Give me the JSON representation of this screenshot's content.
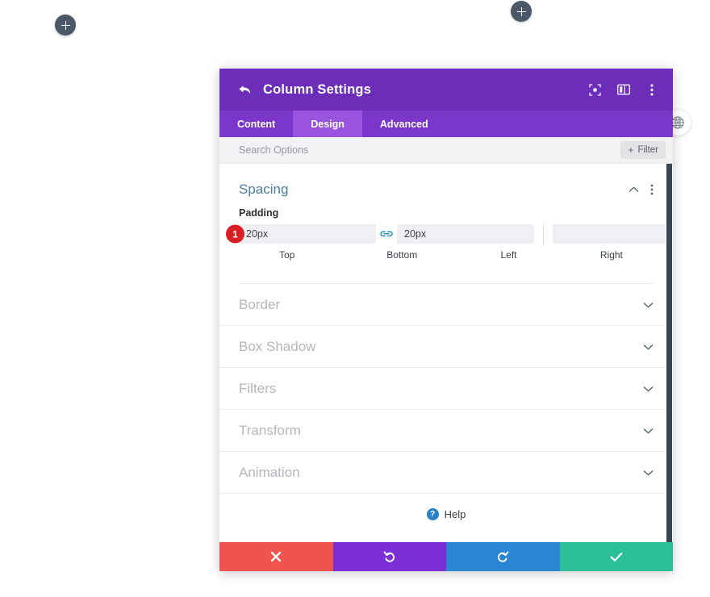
{
  "canvas": {
    "add_buttons": [
      {
        "name": "add-module-left",
        "icon": "plus-icon"
      },
      {
        "name": "add-module-right",
        "icon": "plus-icon"
      }
    ],
    "globe_button": {
      "icon": "globe-icon"
    }
  },
  "modal": {
    "header": {
      "back_icon": "back-arrow-icon",
      "title": "Column Settings",
      "icons": [
        {
          "name": "focus-mode-icon"
        },
        {
          "name": "split-view-icon"
        },
        {
          "name": "more-options-icon"
        }
      ]
    },
    "tabs": [
      {
        "label": "Content",
        "active": false
      },
      {
        "label": "Design",
        "active": true
      },
      {
        "label": "Advanced",
        "active": false
      }
    ],
    "search": {
      "value": "",
      "placeholder": "Search Options"
    },
    "filter_button": {
      "plus": "+",
      "label": "Filter"
    },
    "spacing": {
      "title": "Spacing",
      "collapse_icon": "chevron-up-icon",
      "options_icon": "more-options-icon",
      "padding": {
        "label": "Padding",
        "badge": "1",
        "link_left_icon": "chain-linked-icon",
        "link_right_icon": "chain-broken-icon",
        "fields": [
          {
            "label": "Top",
            "value": "20px",
            "placeholder": ""
          },
          {
            "label": "Bottom",
            "value": "20px",
            "placeholder": ""
          },
          {
            "label": "Left",
            "value": "",
            "placeholder": ""
          },
          {
            "label": "Right",
            "value": "",
            "placeholder": ""
          }
        ]
      }
    },
    "collapsed_sections": [
      {
        "title": "Border",
        "icon": "chevron-down-icon"
      },
      {
        "title": "Box Shadow",
        "icon": "chevron-down-icon"
      },
      {
        "title": "Filters",
        "icon": "chevron-down-icon"
      },
      {
        "title": "Transform",
        "icon": "chevron-down-icon"
      },
      {
        "title": "Animation",
        "icon": "chevron-down-icon"
      }
    ],
    "help": {
      "icon_glyph": "?",
      "label": "Help"
    },
    "footer_buttons": [
      {
        "name": "cancel-button",
        "icon": "close-icon"
      },
      {
        "name": "undo-button",
        "icon": "undo-icon"
      },
      {
        "name": "redo-button",
        "icon": "redo-icon"
      },
      {
        "name": "save-button",
        "icon": "check-icon"
      }
    ]
  },
  "colors": {
    "header_purple": "#6c2eb9",
    "tab_bar_purple": "#7b37c9",
    "tab_active_purple": "#9a54e0",
    "section_title_blue": "#4c7e9e",
    "badge_red": "#d81f26",
    "cancel_red": "#ef5350",
    "undo_purple": "#7b2fd4",
    "redo_blue": "#2a86d3",
    "save_green": "#2bbf9a"
  }
}
